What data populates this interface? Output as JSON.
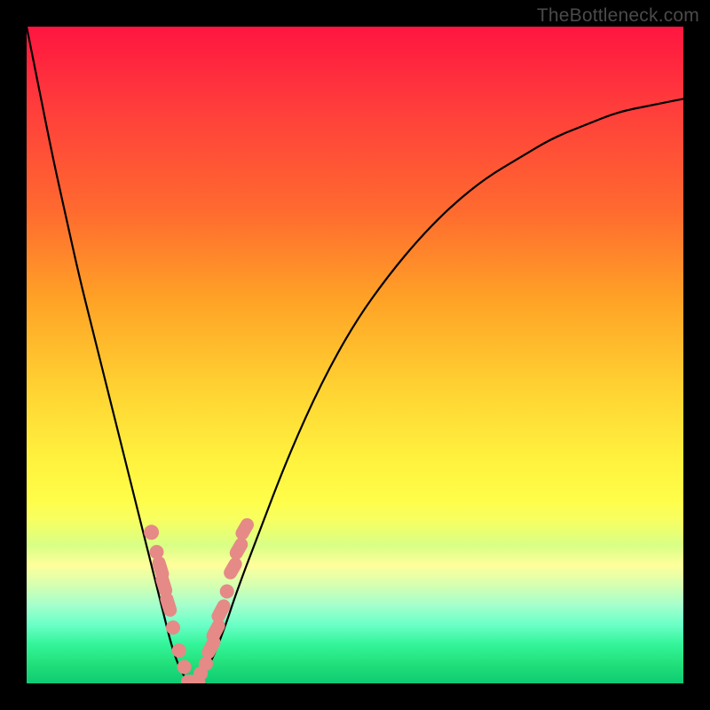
{
  "watermark": "TheBottleneck.com",
  "colors": {
    "frame_background_top": "#ff1540",
    "frame_background_bottom": "#0ecb74",
    "page_background": "#000000",
    "curve": "#000000",
    "beads": "#e58a86",
    "watermark_text": "#4a4a4a"
  },
  "chart_data": {
    "type": "line",
    "title": "",
    "xlabel": "",
    "ylabel": "",
    "xlim": [
      0,
      100
    ],
    "ylim": [
      0,
      100
    ],
    "grid": false,
    "legend": false,
    "x": [
      0,
      2,
      4,
      6,
      8,
      10,
      12,
      14,
      16,
      18,
      20,
      21,
      22,
      23,
      24,
      25,
      26,
      28,
      30,
      32,
      35,
      40,
      45,
      50,
      55,
      60,
      65,
      70,
      75,
      80,
      85,
      90,
      95,
      100
    ],
    "values": [
      100,
      90,
      80,
      71,
      62,
      54,
      46,
      38,
      30,
      22,
      14,
      10,
      6,
      3,
      1,
      0,
      0,
      3,
      8,
      14,
      22,
      35,
      46,
      55,
      62,
      68,
      73,
      77,
      80,
      83,
      85,
      87,
      88,
      89
    ],
    "minimum_x": 25,
    "beads_left": [
      {
        "x": 19.0,
        "y": 23
      },
      {
        "x": 19.8,
        "y": 20
      },
      {
        "x": 20.4,
        "y": 17.5
      },
      {
        "x": 20.9,
        "y": 15
      },
      {
        "x": 21.6,
        "y": 12
      },
      {
        "x": 22.3,
        "y": 8.5
      },
      {
        "x": 23.2,
        "y": 5
      },
      {
        "x": 24.0,
        "y": 2.5
      }
    ],
    "beads_right": [
      {
        "x": 26.5,
        "y": 1.5
      },
      {
        "x": 27.3,
        "y": 3
      },
      {
        "x": 28.1,
        "y": 5.5
      },
      {
        "x": 28.8,
        "y": 8
      },
      {
        "x": 29.6,
        "y": 11
      },
      {
        "x": 30.5,
        "y": 14
      },
      {
        "x": 31.4,
        "y": 17.5
      },
      {
        "x": 32.3,
        "y": 20.5
      },
      {
        "x": 33.2,
        "y": 23.5
      }
    ],
    "beads_bottom": [
      {
        "x": 25.0,
        "y": 0.3
      },
      {
        "x": 25.7,
        "y": 0.2
      }
    ]
  }
}
